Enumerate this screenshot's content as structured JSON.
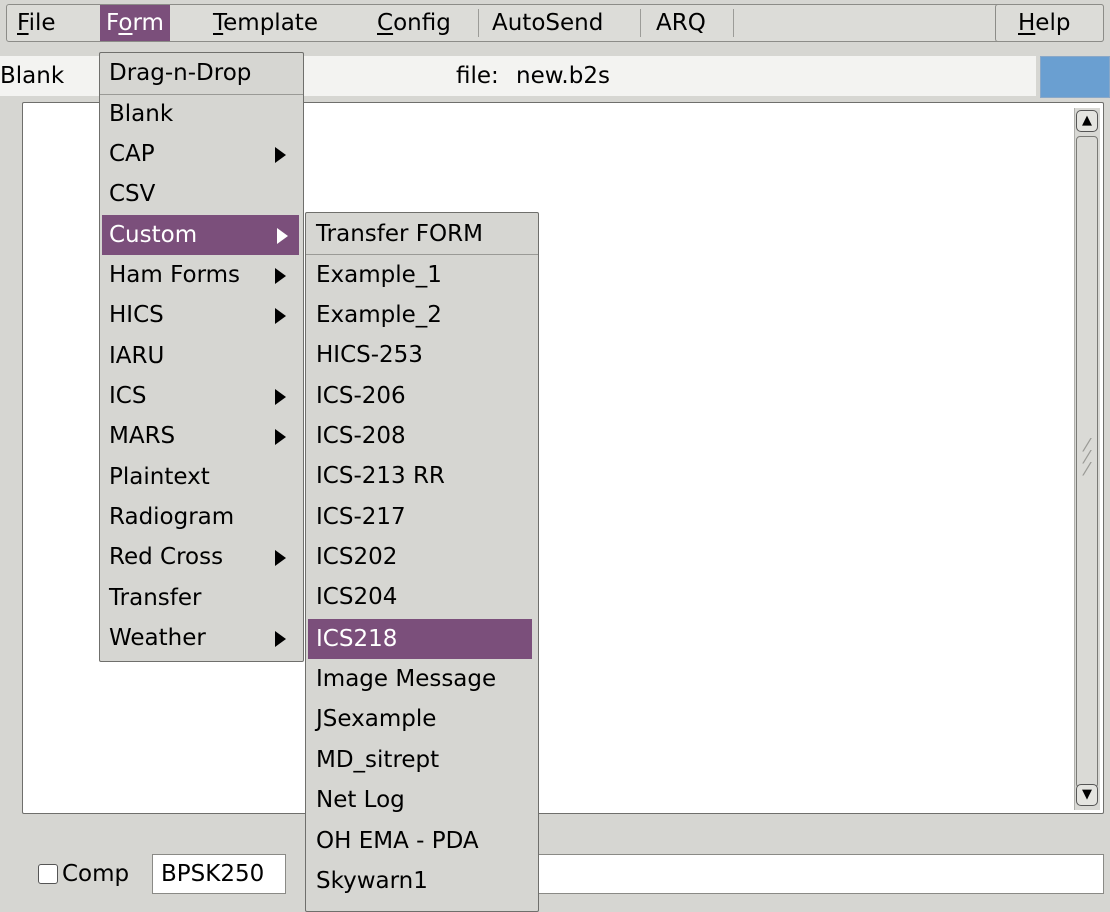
{
  "menubar": {
    "file": {
      "underline": "F",
      "rest": "ile"
    },
    "form": {
      "underline": "o",
      "pre": "F",
      "rest": "rm"
    },
    "template": {
      "underline": "T",
      "rest": "emplate"
    },
    "config": {
      "underline": "C",
      "rest": "onfig"
    },
    "autosend": "AutoSend",
    "arq": "ARQ",
    "help": {
      "underline": "H",
      "rest": "elp"
    }
  },
  "toolbar": {
    "template_value": "Blank",
    "file_label": "file:",
    "file_value": "new.b2s"
  },
  "form_menu": {
    "items": [
      {
        "label": "Drag-n-Drop",
        "submenu": false
      },
      {
        "label": "Blank",
        "submenu": false
      },
      {
        "label": "CAP",
        "submenu": true
      },
      {
        "label": "CSV",
        "submenu": false
      },
      {
        "label": "Custom",
        "submenu": true,
        "active": true
      },
      {
        "label": "Ham Forms",
        "submenu": true
      },
      {
        "label": "HICS",
        "submenu": true
      },
      {
        "label": "IARU",
        "submenu": false
      },
      {
        "label": "ICS",
        "submenu": true
      },
      {
        "label": "MARS",
        "submenu": true
      },
      {
        "label": "Plaintext",
        "submenu": false
      },
      {
        "label": "Radiogram",
        "submenu": false
      },
      {
        "label": "Red Cross",
        "submenu": true
      },
      {
        "label": "Transfer",
        "submenu": false
      },
      {
        "label": "Weather",
        "submenu": true
      }
    ]
  },
  "custom_menu": {
    "items": [
      {
        "label": "Transfer FORM"
      },
      {
        "label": "Example_1"
      },
      {
        "label": "Example_2"
      },
      {
        "label": "HICS-253"
      },
      {
        "label": "ICS-206"
      },
      {
        "label": "ICS-208"
      },
      {
        "label": "ICS-213 RR"
      },
      {
        "label": "ICS-217"
      },
      {
        "label": "ICS202"
      },
      {
        "label": "ICS204"
      },
      {
        "label": "ICS218",
        "active": true
      },
      {
        "label": "Image Message"
      },
      {
        "label": "JSexample"
      },
      {
        "label": "MD_sitrept"
      },
      {
        "label": "Net Log"
      },
      {
        "label": "OH EMA - PDA"
      },
      {
        "label": "Skywarn1"
      }
    ]
  },
  "bottom": {
    "comp_label": "Comp",
    "comp_checked": false,
    "mode_value": "BPSK250"
  },
  "colors": {
    "highlight": "#7b4f7b",
    "status_blue": "#6a9fd1"
  }
}
